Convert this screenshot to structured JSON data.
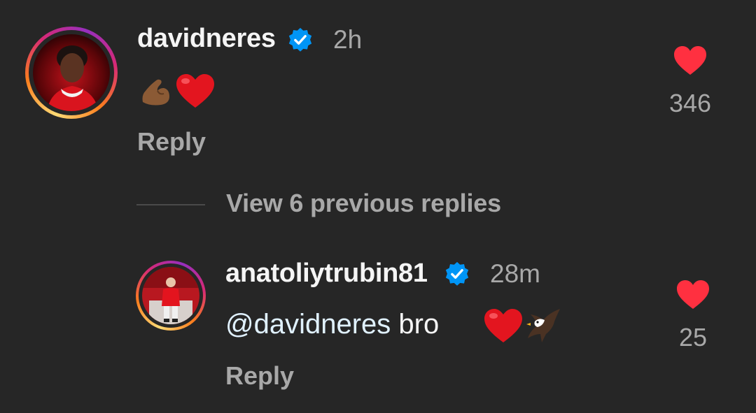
{
  "comments": [
    {
      "username": "davidneres",
      "verified": true,
      "timestamp": "2h",
      "text_emojis": [
        "flexed-biceps-emoji",
        "red-heart-emoji"
      ],
      "reply_label": "Reply",
      "likes": "346"
    },
    {
      "username": "anatoliytrubin81",
      "verified": true,
      "timestamp": "28m",
      "mention": "@davidneres",
      "text": " bro",
      "text_emojis": [
        "red-heart-emoji",
        "eagle-emoji"
      ],
      "reply_label": "Reply",
      "likes": "25"
    }
  ],
  "thread": {
    "view_replies_label": "View 6 previous replies"
  },
  "colors": {
    "background": "#262626",
    "primary_text": "#f5f5f5",
    "secondary_text": "#a8a8a8",
    "like_heart": "#ff3040",
    "verified_badge": "#0095f6"
  }
}
